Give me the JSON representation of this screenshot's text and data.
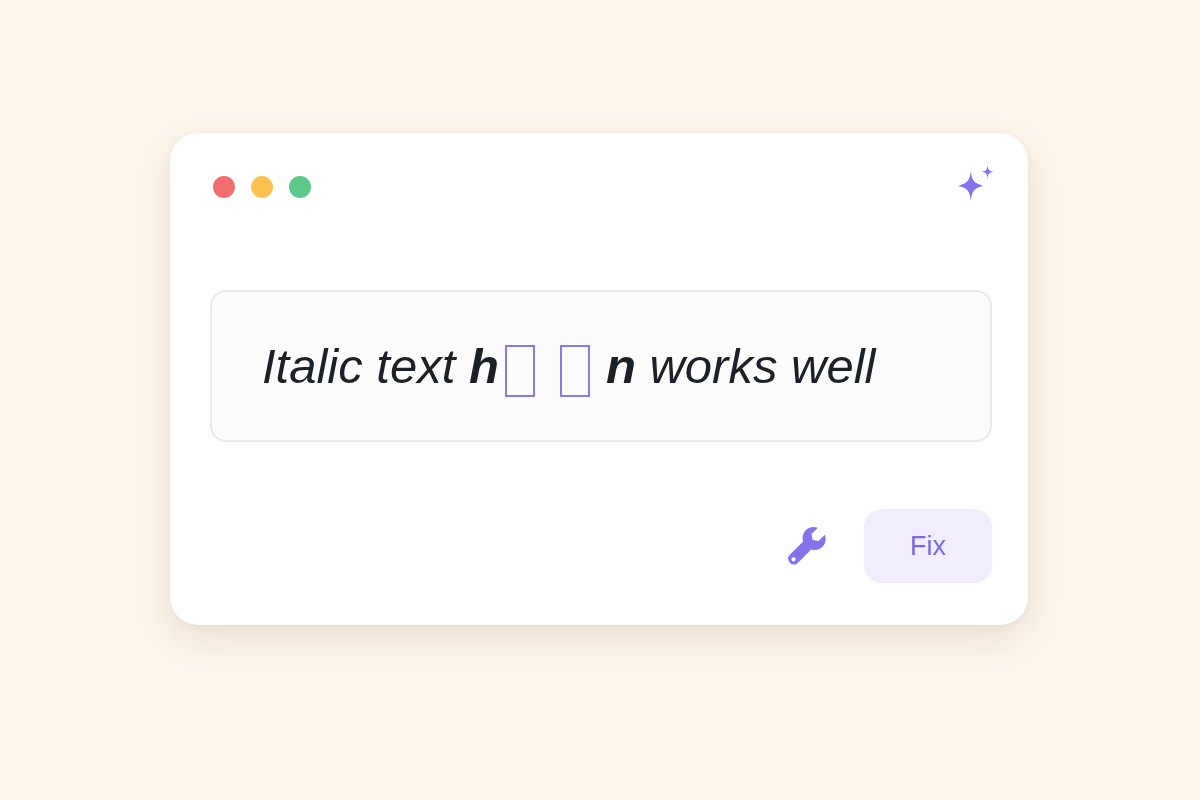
{
  "window": {
    "controls": [
      {
        "color": "#f26d6d"
      },
      {
        "color": "#fbc24f"
      },
      {
        "color": "#5dc98a"
      }
    ]
  },
  "editor": {
    "segments": [
      {
        "kind": "text",
        "text": "Italic text **h**"
      },
      {
        "kind": "missing_glyph"
      },
      {
        "kind": "missing_glyph"
      },
      {
        "kind": "text",
        "text": "**n** works well"
      }
    ]
  },
  "actions": {
    "fix_button": {
      "label": "Fix"
    }
  }
}
